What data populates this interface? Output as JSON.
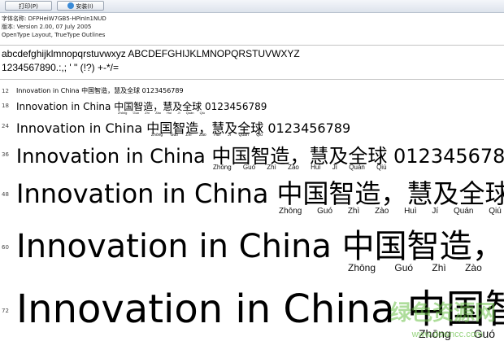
{
  "toolbar": {
    "print_label": "打印(P)",
    "install_label": "安装(I)"
  },
  "info": {
    "font_name": "字体名称: DFPHeiW7GB5-HPinIn1NUD",
    "version": "版本: Version 2.00, 07 July 2005",
    "outline": "OpenType Layout, TrueType Outlines"
  },
  "glyphs": {
    "alphabet": "abcdefghijklmnopqrstuvwxyz ABCDEFGHIJKLMNOPQRSTUVWXYZ",
    "digits": "1234567890.:,; ' \" (!?) +-*/="
  },
  "sample_text": "Innovation in China 中国智造，慧及全球 0123456789",
  "pinyin": [
    "Zhōng",
    "Guó",
    "Zhì",
    "Zào",
    "Huì",
    "Jí",
    "Quán",
    "Qiú"
  ],
  "sizes": [
    "12",
    "18",
    "24",
    "36",
    "48",
    "60",
    "72"
  ],
  "watermark": {
    "text": "绿色资源网",
    "url": "www.downcc.com"
  }
}
